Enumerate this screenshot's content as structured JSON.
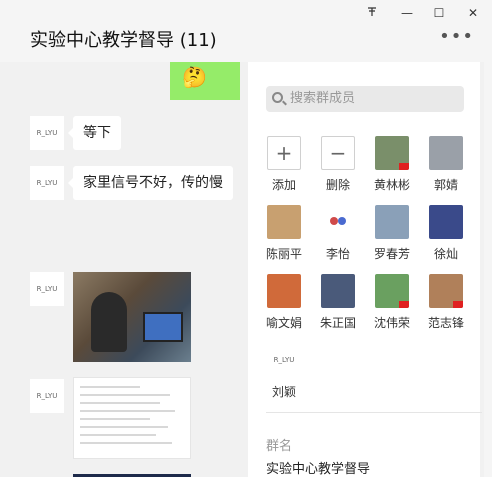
{
  "window": {
    "title": "实验中心教学督导 (11)",
    "controls": {
      "pin": "subway-pin-icon",
      "minimize": "—",
      "maximize": "☐",
      "close": "✕"
    },
    "more": "•••"
  },
  "chat": {
    "sticker_emoji": "🤔",
    "messages": [
      {
        "sender": "R_LYU",
        "text": "等下"
      },
      {
        "sender": "R_LYU",
        "text": "家里信号不好，传的慢"
      },
      {
        "sender": "R_LYU",
        "type": "image"
      },
      {
        "sender": "R_LYU",
        "type": "image"
      }
    ]
  },
  "panel": {
    "search_placeholder": "搜索群成员",
    "actions": {
      "add": "添加",
      "remove": "删除"
    },
    "members": [
      {
        "name": "黄林彬",
        "color": "#7a8f6a",
        "flag": true
      },
      {
        "name": "郭婧",
        "color": "#9aa0a8"
      },
      {
        "name": "陈丽平",
        "color": "#c8a070"
      },
      {
        "name": "李怡",
        "color": "#ffffff"
      },
      {
        "name": "罗春芳",
        "color": "#8aa0b8"
      },
      {
        "name": "徐灿",
        "color": "#3a4a8a"
      },
      {
        "name": "喻文娟",
        "color": "#d06a3a"
      },
      {
        "name": "朱正国",
        "color": "#4a5a7a"
      },
      {
        "name": "沈伟荣",
        "color": "#6aa060",
        "flag": true
      },
      {
        "name": "范志锋",
        "color": "#b0805a",
        "flag": true
      },
      {
        "name": "刘颖",
        "avatar_text": "R_LYU"
      }
    ],
    "group_name_label": "群名",
    "group_name": "实验中心教学督导"
  }
}
